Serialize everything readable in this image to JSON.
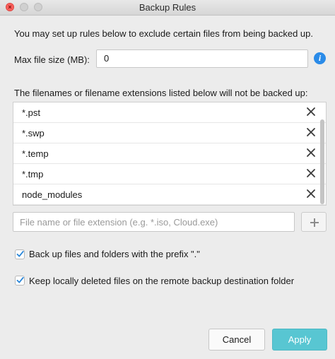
{
  "window": {
    "title": "Backup Rules"
  },
  "dialog": {
    "intro": "You may set up rules below to exclude certain files from being backed up.",
    "max_file_size": {
      "label": "Max file size (MB):",
      "value": "0"
    },
    "list_label": "The filenames or filename extensions listed below will not be backed up:",
    "exclusions": [
      {
        "name": "*.pst"
      },
      {
        "name": "*.swp"
      },
      {
        "name": "*.temp"
      },
      {
        "name": "*.tmp"
      },
      {
        "name": "node_modules"
      }
    ],
    "add_input": {
      "placeholder": "File name or file extension (e.g. *.iso, Cloud.exe)",
      "value": ""
    },
    "options": {
      "backup_prefix": {
        "label": "Back up files and folders with the prefix \".\"",
        "checked": true
      },
      "keep_deleted": {
        "label": "Keep locally deleted files on the remote backup destination folder",
        "checked": true
      }
    },
    "buttons": {
      "cancel": "Cancel",
      "apply": "Apply"
    }
  },
  "colors": {
    "accent": "#58c6d2",
    "info": "#2a8be8",
    "close_traffic": "#fc605c"
  }
}
